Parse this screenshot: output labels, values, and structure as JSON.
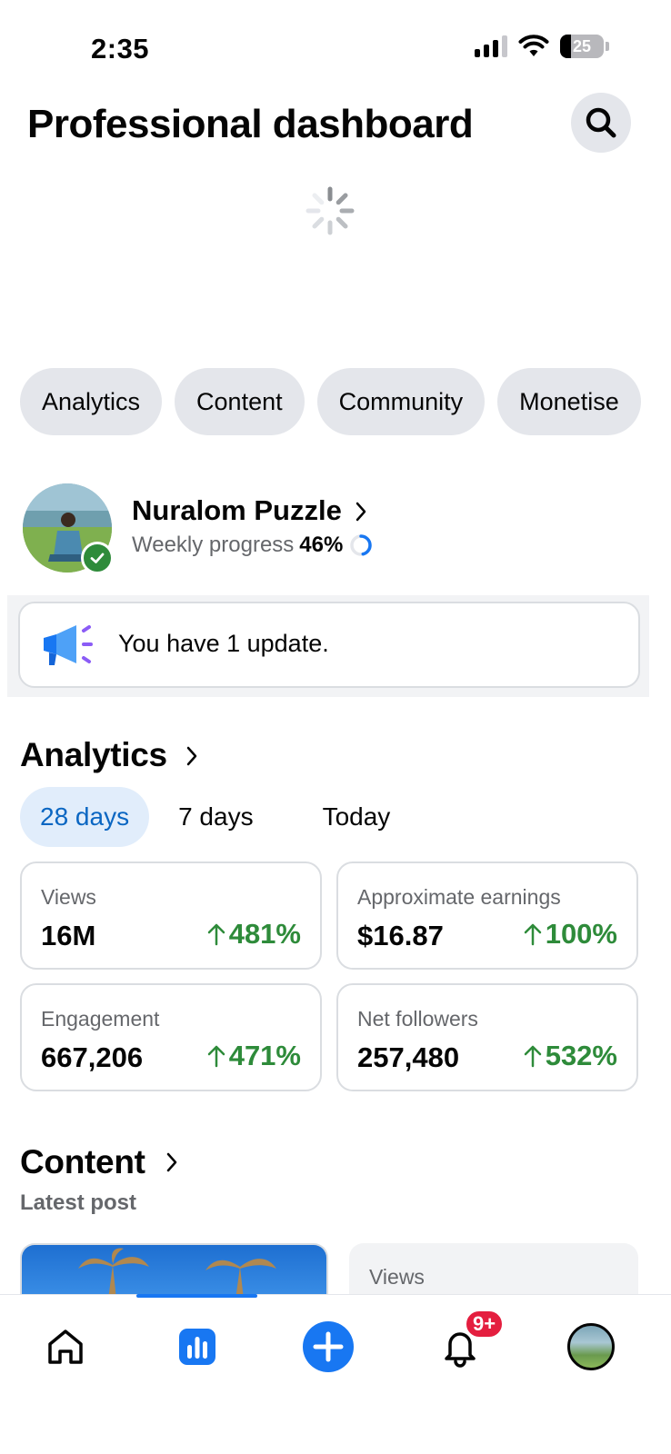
{
  "status_bar": {
    "time": "2:35",
    "battery": "25",
    "battery_level": 0.25
  },
  "header": {
    "title": "Professional dashboard",
    "search_icon": "search-icon"
  },
  "chips": [
    "Analytics",
    "Content",
    "Community",
    "Monetise"
  ],
  "profile": {
    "name": "Nuralom Puzzle",
    "progress_label": "Weekly progress",
    "progress_value": "46%",
    "progress_fraction": 0.46
  },
  "update": {
    "text": "You have 1 update.",
    "icon": "megaphone-icon"
  },
  "analytics": {
    "title": "Analytics",
    "ranges": [
      "28 days",
      "7 days",
      "Today"
    ],
    "active_range": "28 days",
    "metrics": [
      {
        "label": "Views",
        "value": "16M",
        "change": "481%"
      },
      {
        "label": "Approximate earnings",
        "value": "$16.87",
        "change": "100%"
      },
      {
        "label": "Engagement",
        "value": "667,206",
        "change": "471%"
      },
      {
        "label": "Net followers",
        "value": "257,480",
        "change": "532%"
      }
    ],
    "positive_color": "#2e8b3a"
  },
  "content": {
    "title": "Content",
    "subtitle": "Latest post",
    "views_label": "Views"
  },
  "nav": {
    "items": [
      "home-icon",
      "dashboard-icon",
      "create-icon",
      "notifications-icon",
      "profile-avatar"
    ],
    "notification_badge": "9+",
    "accent": "#1877f2"
  }
}
